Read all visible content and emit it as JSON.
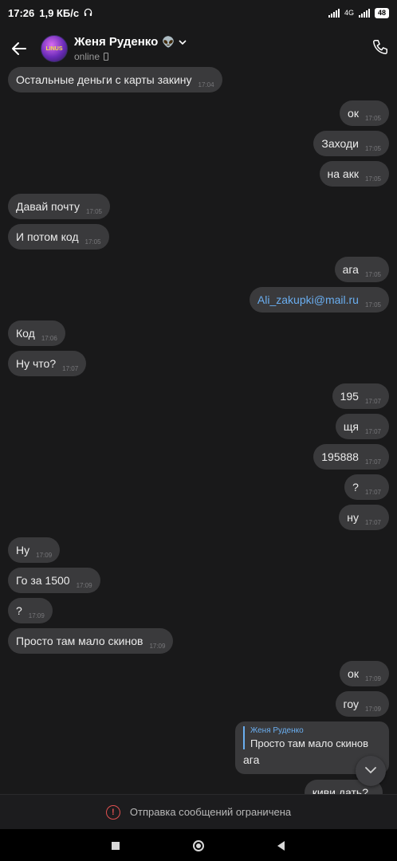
{
  "status_bar": {
    "time": "17:26",
    "speed": "1,9 КБ/с",
    "network": "4G",
    "battery": "48"
  },
  "header": {
    "contact_name": "Женя Руденко",
    "contact_emoji": "👽",
    "contact_status": "online",
    "avatar_text": "LINUS"
  },
  "messages": [
    {
      "dir": "in",
      "text": "Остальные деньги с карты закину",
      "time": "17:04"
    },
    {
      "dir": "out",
      "text": "ок",
      "time": "17:05"
    },
    {
      "dir": "out",
      "text": "Заходи",
      "time": "17:05"
    },
    {
      "dir": "out",
      "text": "на акк",
      "time": "17:05"
    },
    {
      "dir": "in",
      "text": "Давай почту",
      "time": "17:05"
    },
    {
      "dir": "in",
      "text": "И потом код",
      "time": "17:05"
    },
    {
      "dir": "out",
      "text": "ага",
      "time": "17:05"
    },
    {
      "dir": "out",
      "text": "Ali_zakupki@mail.ru",
      "time": "17:05"
    },
    {
      "dir": "in",
      "text": "Код",
      "time": "17:06"
    },
    {
      "dir": "in",
      "text": "Ну что?",
      "time": "17:07"
    },
    {
      "dir": "out",
      "text": "195",
      "time": "17:07"
    },
    {
      "dir": "out",
      "text": "щя",
      "time": "17:07"
    },
    {
      "dir": "out",
      "text": "195888",
      "time": "17:07"
    },
    {
      "dir": "out",
      "text": "?",
      "time": "17:07"
    },
    {
      "dir": "out",
      "text": "ну",
      "time": "17:07"
    },
    {
      "dir": "in",
      "text": "Ну",
      "time": "17:09"
    },
    {
      "dir": "in",
      "text": "Го за 1500",
      "time": "17:09"
    },
    {
      "dir": "in",
      "text": "?",
      "time": "17:09"
    },
    {
      "dir": "in",
      "text": "Просто там мало скинов",
      "time": "17:09"
    },
    {
      "dir": "out",
      "text": "ок",
      "time": "17:09"
    },
    {
      "dir": "out",
      "text": "гоу",
      "time": "17:09"
    },
    {
      "dir": "out",
      "text": "киви дать?",
      "time": ""
    }
  ],
  "reply_message": {
    "quote_author": "Женя Руденко",
    "quote_text": "Просто там мало скинов",
    "text": "ага"
  },
  "restriction": {
    "text": "Отправка сообщений ограничена"
  },
  "colors": {
    "background": "#19191a",
    "bubble": "#3a3a3c",
    "link": "#6aaef0",
    "warning": "#e05050"
  }
}
